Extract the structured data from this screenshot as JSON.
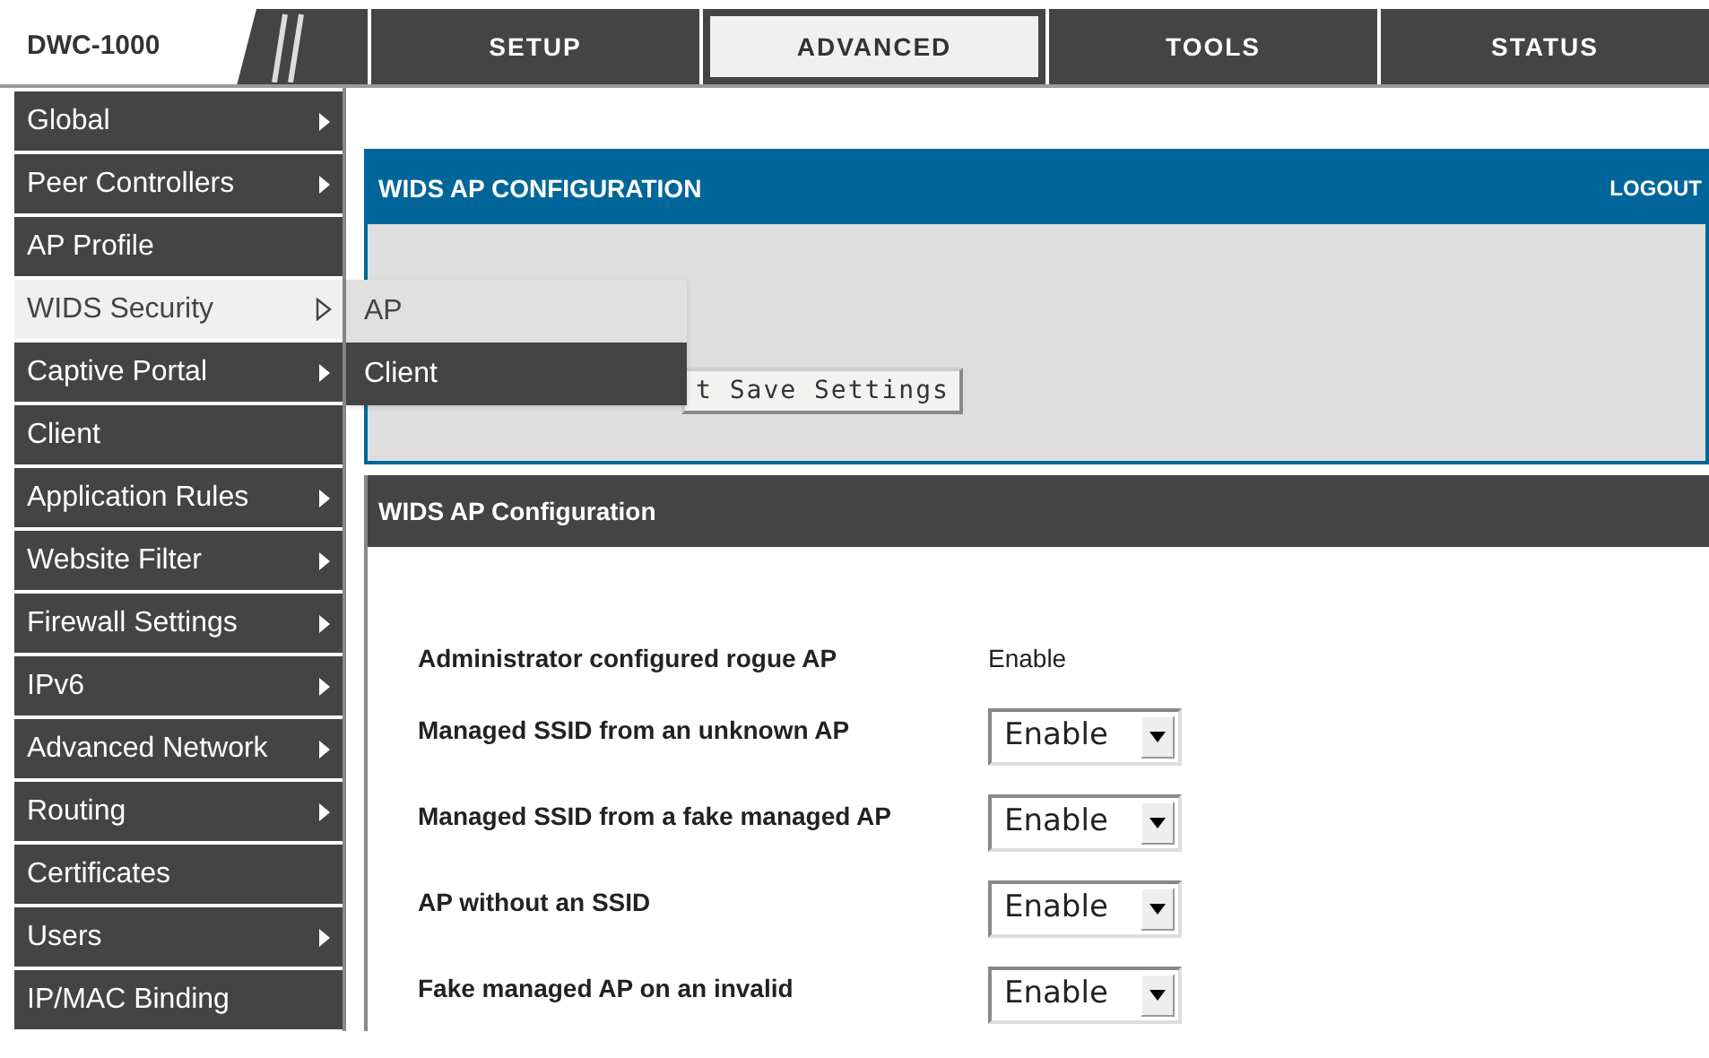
{
  "logo": {
    "text": "DWC-1000"
  },
  "tabs": [
    {
      "label": "SETUP",
      "selected": false
    },
    {
      "label": "ADVANCED",
      "selected": true
    },
    {
      "label": "TOOLS",
      "selected": false
    },
    {
      "label": "STATUS",
      "selected": false
    }
  ],
  "sidebar": {
    "items": [
      {
        "label": "Global",
        "submenu": true,
        "selected": false
      },
      {
        "label": "Peer Controllers",
        "submenu": true,
        "selected": false
      },
      {
        "label": "AP Profile",
        "submenu": false,
        "selected": false
      },
      {
        "label": "WIDS Security",
        "submenu": true,
        "selected": true
      },
      {
        "label": "Captive Portal",
        "submenu": true,
        "selected": false
      },
      {
        "label": "Client",
        "submenu": false,
        "selected": false
      },
      {
        "label": "Application Rules",
        "submenu": true,
        "selected": false
      },
      {
        "label": "Website Filter",
        "submenu": true,
        "selected": false
      },
      {
        "label": "Firewall Settings",
        "submenu": true,
        "selected": false
      },
      {
        "label": "IPv6",
        "submenu": true,
        "selected": false
      },
      {
        "label": "Advanced Network",
        "submenu": true,
        "selected": false
      },
      {
        "label": "Routing",
        "submenu": true,
        "selected": false
      },
      {
        "label": "Certificates",
        "submenu": false,
        "selected": false
      },
      {
        "label": "Users",
        "submenu": true,
        "selected": false
      },
      {
        "label": "IP/MAC Binding",
        "submenu": false,
        "selected": false
      }
    ]
  },
  "submenu": {
    "items": [
      {
        "label": "AP",
        "selected": true
      },
      {
        "label": "Client",
        "selected": false
      }
    ]
  },
  "header": {
    "title": "WIDS AP CONFIGURATION",
    "logout": "LOGOUT",
    "button": "t Save Settings"
  },
  "section": {
    "title": "WIDS AP Configuration",
    "rows": [
      {
        "label": "Administrator configured rogue AP",
        "kind": "text",
        "value": "Enable"
      },
      {
        "label": "Managed SSID from an unknown AP",
        "kind": "select",
        "value": "Enable"
      },
      {
        "label": "Managed SSID from a fake managed AP",
        "kind": "select",
        "value": "Enable"
      },
      {
        "label": "AP without an SSID",
        "kind": "select",
        "value": "Enable"
      },
      {
        "label": "Fake managed AP on an invalid",
        "kind": "select",
        "value": "Enable"
      }
    ]
  }
}
